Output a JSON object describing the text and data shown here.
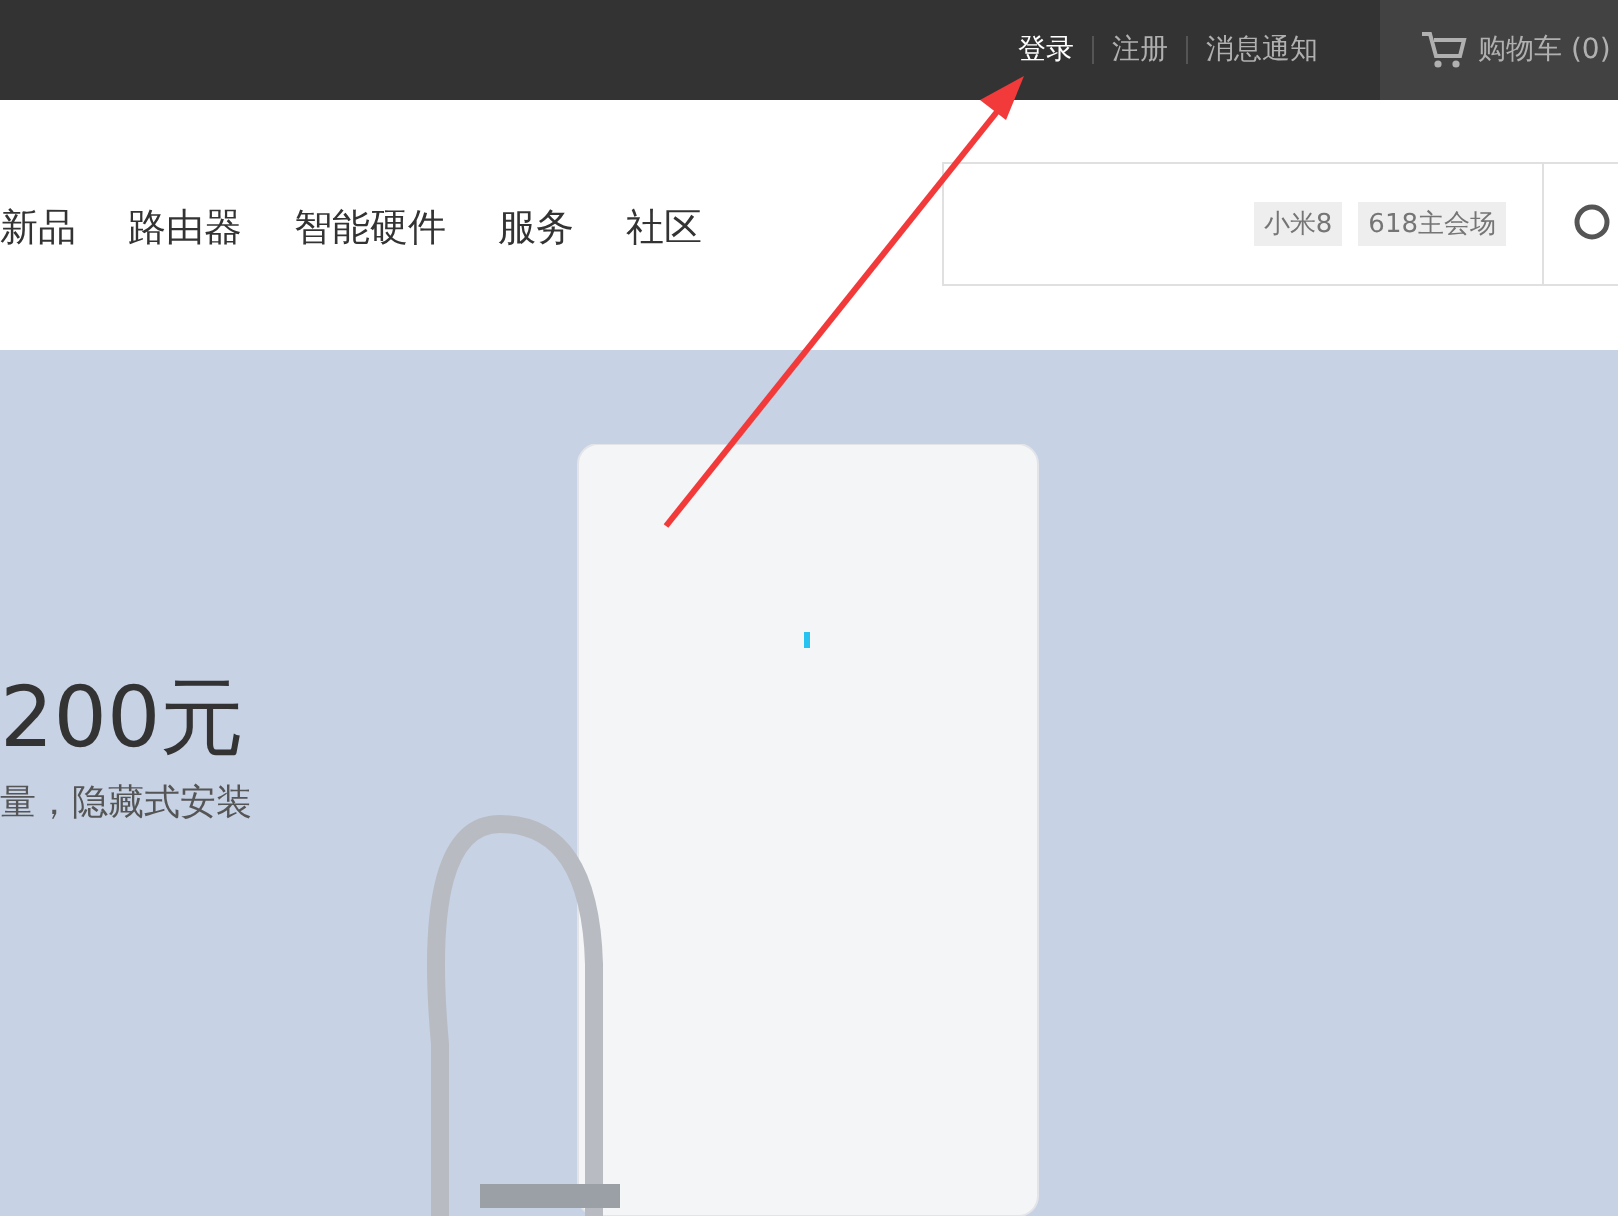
{
  "top_bar": {
    "links": [
      {
        "label": "登录",
        "selected": true
      },
      {
        "label": "注册",
        "selected": false
      },
      {
        "label": "消息通知",
        "selected": false
      }
    ],
    "cart": "购物车 (0)"
  },
  "nav": {
    "items": [
      "新品",
      "路由器",
      "智能硬件",
      "服务",
      "社区"
    ]
  },
  "search": {
    "tags": [
      "小米8",
      "618主会场"
    ]
  },
  "banner": {
    "price": "200元",
    "subtitle": "量，隐藏式安装"
  }
}
